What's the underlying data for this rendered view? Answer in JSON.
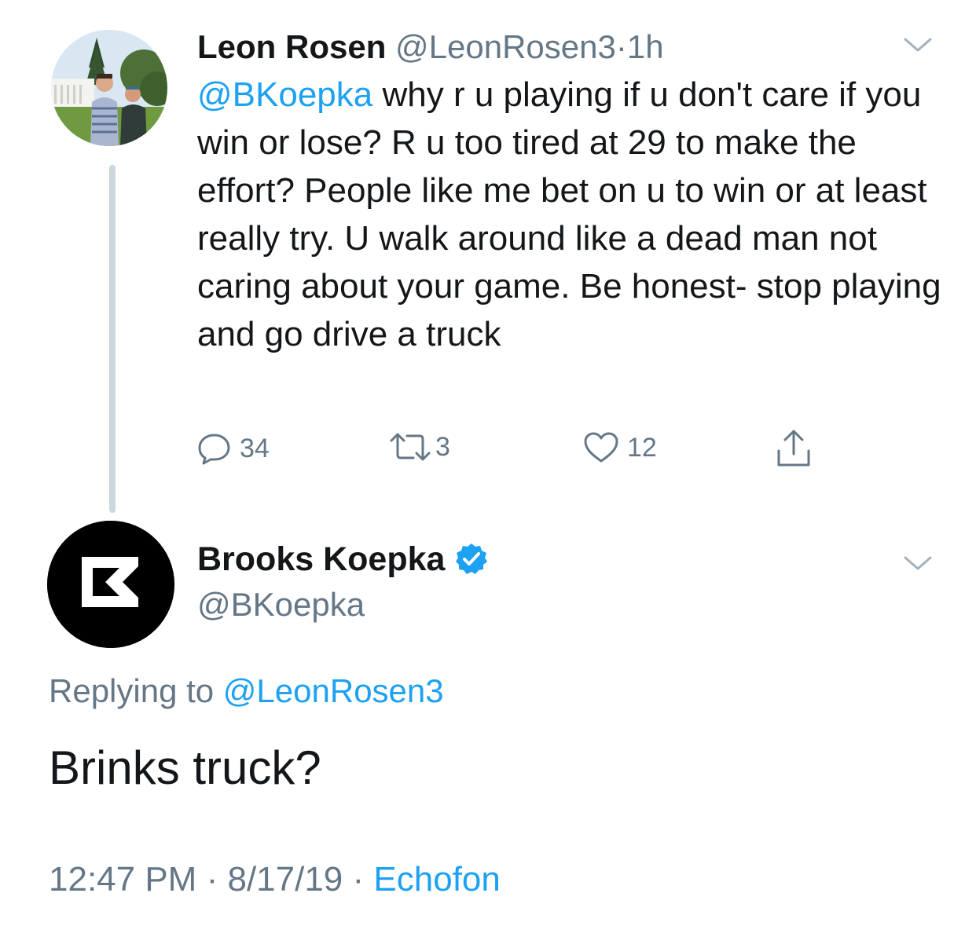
{
  "original_tweet": {
    "author_name": "Leon Rosen",
    "author_handle": "@LeonRosen3",
    "separator": "·",
    "time_ago": "1h",
    "mention": "@BKoepka",
    "text": " why r u playing if u don't care if you win or lose? R u too tired at 29 to make the effort? People like me bet on u to win or at least really try. U walk around like a dead man not caring about your game. Be honest- stop playing and go drive a truck",
    "avatar_icon": "profile-photo",
    "actions": {
      "reply_icon": "speech-bubble-icon",
      "reply_count": "34",
      "retweet_icon": "retweet-icon",
      "retweet_count": "3",
      "like_icon": "heart-icon",
      "like_count": "12",
      "share_icon": "share-icon"
    }
  },
  "reply_tweet": {
    "author_name": "Brooks Koepka",
    "verified": true,
    "author_handle": "@BKoepka",
    "avatar_icon": "bk-logo",
    "replying_label": "Replying to",
    "replying_handle": "@LeonRosen3",
    "text": "Brinks truck?",
    "time": "12:47 PM",
    "separator": "·",
    "date": "8/17/19",
    "source": "Echofon"
  },
  "colors": {
    "link_blue": "#1da1f2",
    "meta_gray": "#657786",
    "text_dark": "#14171a",
    "thread_line": "#ccd6dd"
  }
}
